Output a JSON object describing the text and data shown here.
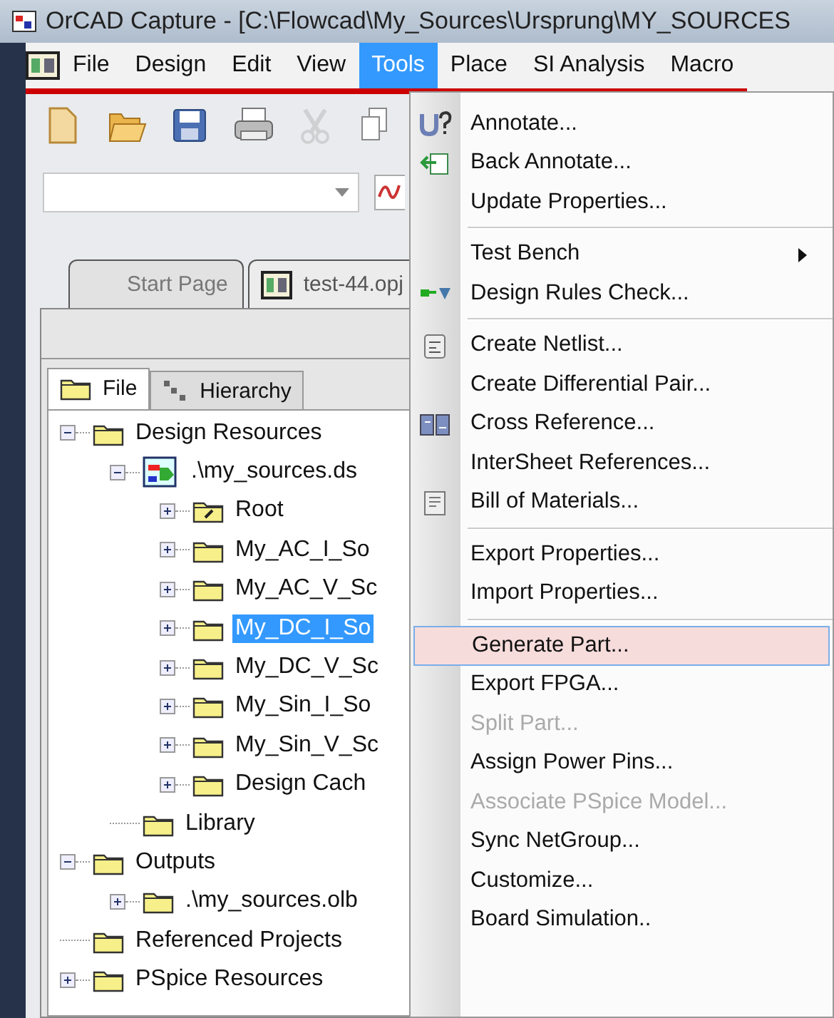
{
  "window": {
    "title": "OrCAD Capture - [C:\\Flowcad\\My_Sources\\Ursprung\\MY_SOURCES"
  },
  "menubar": [
    {
      "label": "File",
      "selected": false
    },
    {
      "label": "Design",
      "selected": false
    },
    {
      "label": "Edit",
      "selected": false
    },
    {
      "label": "View",
      "selected": false
    },
    {
      "label": "Tools",
      "selected": true
    },
    {
      "label": "Place",
      "selected": false
    },
    {
      "label": "SI Analysis",
      "selected": false
    },
    {
      "label": "Macro",
      "selected": false
    }
  ],
  "toolbar": [
    {
      "kind": "new",
      "disabled": false
    },
    {
      "kind": "open",
      "disabled": false
    },
    {
      "kind": "save",
      "disabled": false
    },
    {
      "kind": "print",
      "disabled": false
    },
    {
      "kind": "cut",
      "disabled": true
    },
    {
      "kind": "copy",
      "disabled": false
    }
  ],
  "doc_tabs": [
    {
      "label": "Start Page",
      "selected": false,
      "kind": "plain"
    },
    {
      "label": "test-44.opj",
      "selected": true,
      "kind": "project"
    }
  ],
  "panel_tabs": [
    {
      "label": "File",
      "selected": true,
      "kind": "folder"
    },
    {
      "label": "Hierarchy",
      "selected": false,
      "kind": "hierarchy"
    }
  ],
  "tree": [
    {
      "label": "Design Resources",
      "kind": "folder",
      "expandable": true,
      "expanded": true,
      "selected": false,
      "children": [
        {
          "label": ".\\my_sources.ds",
          "kind": "design",
          "expandable": true,
          "expanded": true,
          "selected": false,
          "children": [
            {
              "label": "Root",
              "kind": "root",
              "expandable": true,
              "expanded": false,
              "selected": false
            },
            {
              "label": "My_AC_I_So",
              "kind": "folder",
              "expandable": true,
              "expanded": false,
              "selected": false
            },
            {
              "label": "My_AC_V_Sc",
              "kind": "folder",
              "expandable": true,
              "expanded": false,
              "selected": false
            },
            {
              "label": "My_DC_I_So",
              "kind": "folder",
              "expandable": true,
              "expanded": false,
              "selected": true
            },
            {
              "label": "My_DC_V_Sc",
              "kind": "folder",
              "expandable": true,
              "expanded": false,
              "selected": false
            },
            {
              "label": "My_Sin_I_So",
              "kind": "folder",
              "expandable": true,
              "expanded": false,
              "selected": false
            },
            {
              "label": "My_Sin_V_Sc",
              "kind": "folder",
              "expandable": true,
              "expanded": false,
              "selected": false
            },
            {
              "label": "Design Cach",
              "kind": "folder",
              "expandable": true,
              "expanded": false,
              "selected": false
            }
          ]
        },
        {
          "label": "Library",
          "kind": "folder",
          "selected": false
        }
      ]
    },
    {
      "label": "Outputs",
      "kind": "folder",
      "expandable": true,
      "expanded": true,
      "selected": false,
      "children": [
        {
          "label": ".\\my_sources.olb",
          "kind": "folder",
          "expandable": true,
          "expanded": false,
          "selected": false
        }
      ]
    },
    {
      "label": "Referenced Projects",
      "kind": "folder",
      "selected": false
    },
    {
      "label": "PSpice Resources",
      "kind": "folder",
      "expandable": true,
      "expanded": false,
      "selected": false
    }
  ],
  "tools_menu": [
    {
      "kind": "annotate",
      "label": "Annotate...",
      "submenu": false,
      "disabled": false,
      "selected": false
    },
    {
      "kind": "back-annotate",
      "label": "Back Annotate...",
      "submenu": false,
      "disabled": false,
      "selected": false
    },
    {
      "kind": "plain",
      "label": "Update Properties...",
      "submenu": false,
      "disabled": false,
      "selected": false
    },
    {
      "kind": "separator"
    },
    {
      "kind": "plain",
      "label": "Test Bench",
      "submenu": true,
      "disabled": false,
      "selected": false
    },
    {
      "kind": "drc",
      "label": "Design Rules Check...",
      "submenu": false,
      "disabled": false,
      "selected": false
    },
    {
      "kind": "separator"
    },
    {
      "kind": "netlist",
      "label": "Create Netlist...",
      "submenu": false,
      "disabled": false,
      "selected": false
    },
    {
      "kind": "plain",
      "label": "Create Differential Pair...",
      "submenu": false,
      "disabled": false,
      "selected": false
    },
    {
      "kind": "cross-ref",
      "label": "Cross Reference...",
      "submenu": false,
      "disabled": false,
      "selected": false
    },
    {
      "kind": "plain",
      "label": "InterSheet References...",
      "submenu": false,
      "disabled": false,
      "selected": false
    },
    {
      "kind": "bom",
      "label": "Bill of Materials...",
      "submenu": false,
      "disabled": false,
      "selected": false
    },
    {
      "kind": "separator"
    },
    {
      "kind": "plain",
      "label": "Export Properties...",
      "submenu": false,
      "disabled": false,
      "selected": false
    },
    {
      "kind": "plain",
      "label": "Import Properties...",
      "submenu": false,
      "disabled": false,
      "selected": false
    },
    {
      "kind": "separator"
    },
    {
      "kind": "plain",
      "label": "Generate Part...",
      "submenu": false,
      "disabled": false,
      "selected": true
    },
    {
      "kind": "plain",
      "label": "Export FPGA...",
      "submenu": false,
      "disabled": false,
      "selected": false
    },
    {
      "kind": "plain",
      "label": "Split Part...",
      "submenu": false,
      "disabled": true,
      "selected": false
    },
    {
      "kind": "plain",
      "label": "Assign Power Pins...",
      "submenu": false,
      "disabled": false,
      "selected": false
    },
    {
      "kind": "plain",
      "label": "Associate PSpice Model...",
      "submenu": false,
      "disabled": true,
      "selected": false
    },
    {
      "kind": "plain",
      "label": "Sync NetGroup...",
      "submenu": false,
      "disabled": false,
      "selected": false
    },
    {
      "kind": "plain",
      "label": "Customize...",
      "submenu": false,
      "disabled": false,
      "selected": false
    },
    {
      "kind": "plain",
      "label": "Board Simulation..",
      "submenu": false,
      "disabled": false,
      "selected": false
    }
  ]
}
